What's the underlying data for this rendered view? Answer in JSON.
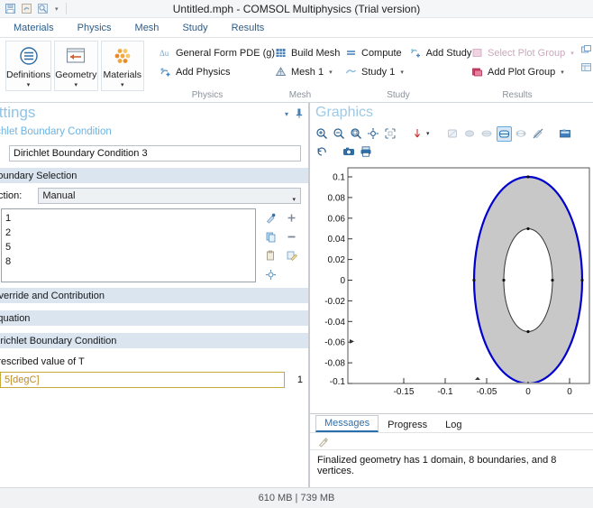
{
  "window": {
    "title": "Untitled.mph - COMSOL Multiphysics (Trial version)"
  },
  "quick_access": {
    "icons": [
      "save-icon",
      "undo-icon",
      "redo-icon"
    ],
    "caret": "▾"
  },
  "menubar": {
    "items": [
      {
        "label": "Materials",
        "name": "tab-materials"
      },
      {
        "label": "Physics",
        "name": "tab-physics"
      },
      {
        "label": "Mesh",
        "name": "tab-mesh"
      },
      {
        "label": "Study",
        "name": "tab-study"
      },
      {
        "label": "Results",
        "name": "tab-results"
      }
    ]
  },
  "ribbon": {
    "big_buttons": [
      {
        "label": "Definitions",
        "icon": "definitions-icon",
        "caret": "▾"
      },
      {
        "label": "Geometry",
        "icon": "geometry-icon",
        "caret": "▾"
      },
      {
        "label": "Materials",
        "icon": "materials-icon",
        "caret": "▾"
      }
    ],
    "groups": [
      {
        "label": "Physics",
        "name": "ribbon-group-physics",
        "rows": [
          {
            "label": "General Form PDE (g)",
            "icon": "pde-icon",
            "caret": "▾",
            "disabled": false
          },
          {
            "label": "Add Physics",
            "icon": "add-physics-icon",
            "caret": "",
            "disabled": false
          }
        ]
      },
      {
        "label": "Mesh",
        "name": "ribbon-group-mesh",
        "rows": [
          {
            "label": "Build Mesh",
            "icon": "build-mesh-icon",
            "caret": "",
            "disabled": false
          },
          {
            "label": "Mesh 1",
            "icon": "mesh1-icon",
            "caret": "▾",
            "disabled": false
          }
        ]
      },
      {
        "label": "Study",
        "name": "ribbon-group-study",
        "rows": [
          {
            "label": "Compute",
            "icon": "compute-icon",
            "caret": "",
            "disabled": false
          },
          {
            "label": "Add Study",
            "icon": "add-study-icon",
            "caret": "",
            "disabled": false
          },
          {
            "label": "Study 1",
            "icon": "study1-icon",
            "caret": "▾",
            "disabled": false
          }
        ]
      },
      {
        "label": "Results",
        "name": "ribbon-group-results",
        "rows": [
          {
            "label": "Select Plot Group",
            "icon": "select-plot-group-icon",
            "caret": "▾",
            "disabled": true
          },
          {
            "label": "Add Plot Group",
            "icon": "add-plot-group-icon",
            "caret": "▾",
            "disabled": false
          }
        ]
      }
    ]
  },
  "settings": {
    "panel_title": "Settings",
    "node_title": "Dirichlet Boundary Condition",
    "label_value": "Dirichlet Boundary Condition 3",
    "collapse_caret": "▾",
    "pin_icon": "pin-icon",
    "sections": {
      "boundary_selection": {
        "header": "Boundary Selection",
        "selection_label": "Selection:",
        "selection_value": "Manual",
        "selection_arrow": "▾",
        "list_items": [
          "1",
          "2",
          "5",
          "8"
        ],
        "side_tools": [
          "pointer-select-icon",
          "box-select-icon"
        ],
        "list_buttons": [
          "active-icon",
          "add-icon",
          "copy-icon",
          "remove-icon",
          "paste-icon",
          "clear-icon",
          "zoom-selected-icon"
        ]
      },
      "override_and_contribution": {
        "header": "Override and Contribution"
      },
      "equation": {
        "header": "Equation"
      },
      "dirichlet_boundary_condition": {
        "header": "Dirichlet Boundary Condition",
        "prescribed_label": "Prescribed value of T",
        "prescribed_value": "5[degC]",
        "prescribed_unit": "1"
      }
    }
  },
  "graphics": {
    "title": "Graphics",
    "toolbar_row1": [
      "zoom-in-icon",
      "zoom-out-icon",
      "zoom-box-icon",
      "zoom-extents-icon",
      "zoom-to-selection-icon",
      "axis-orientation-icon",
      "orientation-caret",
      "transparency-icon",
      "scene-light-icon",
      "wireframe-icon",
      "select-mode-icon",
      "measure-icon",
      "hide-icon",
      "image-snapshot-icon"
    ],
    "toolbar_row2": [
      "reset-view-icon",
      "camera-icon",
      "print-icon"
    ],
    "caret": "▾"
  },
  "chart_data": {
    "type": "scatter",
    "title": "",
    "xlabel": "",
    "ylabel": "",
    "xlim": [
      -0.185,
      0.012
    ],
    "ylim": [
      -0.108,
      0.108
    ],
    "xticks": [
      -0.15,
      -0.1,
      -0.05,
      0
    ],
    "xticklabels": [
      "-0.15",
      "-0.1",
      "-0.05",
      "0"
    ],
    "yticks": [
      -0.1,
      -0.08,
      -0.06,
      -0.04,
      -0.02,
      0,
      0.02,
      0.04,
      0.06,
      0.08,
      0.1
    ],
    "yticklabels": [
      "-0.1",
      "-0.08",
      "-0.06",
      "-0.04",
      "-0.02",
      "0",
      "0.02",
      "0.04",
      "0.06",
      "0.08",
      "0.1"
    ],
    "grid": false,
    "geometry": {
      "description": "2D elliptical annulus domain; outer ellipse highlighted (selected boundaries)",
      "outer_ellipse": {
        "cx": 0.0,
        "cy": 0.0,
        "rx": 0.065,
        "ry": 0.1,
        "stroke": "#0000cc",
        "fill": "#c8c8c8"
      },
      "inner_ellipse": {
        "cx": 0.0,
        "cy": 0.0,
        "rx": 0.029,
        "ry": 0.05,
        "stroke": "#333333",
        "fill": "#ffffff"
      },
      "vertices": [
        {
          "x": -0.065,
          "y": 0.0
        },
        {
          "x": 0.065,
          "y": 0.0
        },
        {
          "x": 0.0,
          "y": 0.1
        },
        {
          "x": 0.0,
          "y": -0.1
        },
        {
          "x": -0.029,
          "y": 0.0
        },
        {
          "x": 0.029,
          "y": 0.0
        },
        {
          "x": 0.0,
          "y": 0.05
        },
        {
          "x": 0.0,
          "y": -0.05
        }
      ]
    },
    "colors": {
      "selected_boundary": "#0000cc",
      "domain_fill": "#c8c8c8",
      "edge": "#333333"
    }
  },
  "messages": {
    "tabs": [
      {
        "label": "Messages",
        "active": true
      },
      {
        "label": "Progress",
        "active": false
      },
      {
        "label": "Log",
        "active": false
      }
    ],
    "toolbar_icon": "clear-messages-icon",
    "text": "Finalized geometry has 1 domain, 8 boundaries, and 8 vertices."
  },
  "statusbar": {
    "memory": "610 MB | 739 MB"
  }
}
